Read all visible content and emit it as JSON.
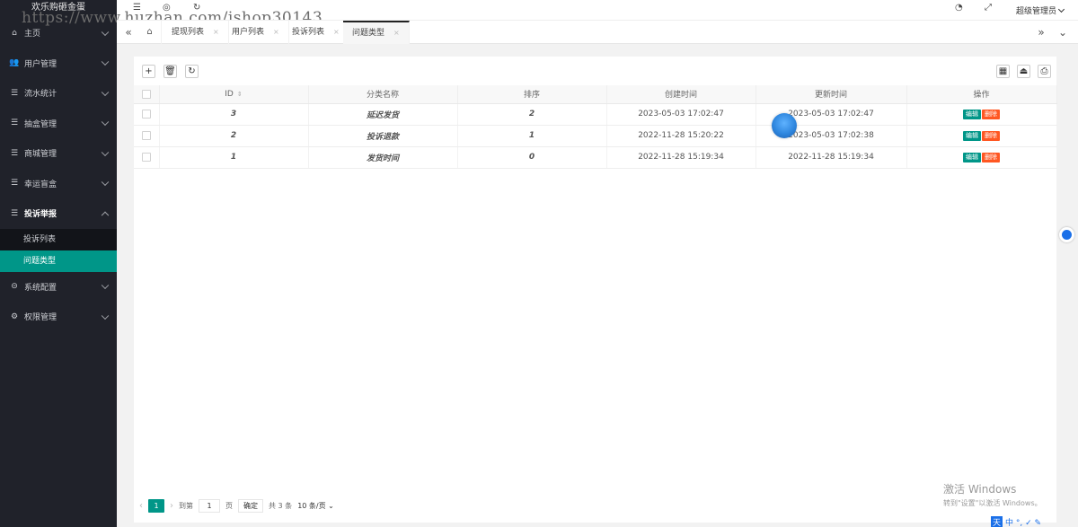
{
  "brand": "欢乐购砸金蛋",
  "watermark": "https://www.huzhan.com/ishop30143",
  "header": {
    "user": "超级管理员"
  },
  "sidebar": {
    "items": [
      {
        "label": "主页",
        "icon": "home-icon",
        "glyph": "⌂"
      },
      {
        "label": "用户管理",
        "icon": "users-icon",
        "glyph": "👥"
      },
      {
        "label": "流水统计",
        "icon": "list-icon",
        "glyph": "☰"
      },
      {
        "label": "抽盒管理",
        "icon": "list-icon",
        "glyph": "☰"
      },
      {
        "label": "商城管理",
        "icon": "list-icon",
        "glyph": "☰"
      },
      {
        "label": "幸运盲盒",
        "icon": "list-icon",
        "glyph": "☰"
      },
      {
        "label": "投诉举报",
        "icon": "list-icon",
        "glyph": "☰"
      }
    ],
    "sub_items": [
      "投诉列表",
      "问题类型"
    ],
    "items_after": [
      {
        "label": "系统配置",
        "icon": "settings-icon",
        "glyph": "⊝"
      },
      {
        "label": "权限管理",
        "icon": "gear-icon",
        "glyph": "⚙"
      }
    ]
  },
  "tabs": [
    "提现列表",
    "用户列表",
    "投诉列表",
    "问题类型"
  ],
  "tab_close": "×",
  "table": {
    "columns": [
      "ID",
      "分类名称",
      "排序",
      "创建时间",
      "更新时间",
      "操作"
    ],
    "rows": [
      {
        "id": "3",
        "name": "延迟发货",
        "sort": "2",
        "created": "2023-05-03 17:02:47",
        "updated": "2023-05-03 17:02:47"
      },
      {
        "id": "2",
        "name": "投诉退款",
        "sort": "1",
        "created": "2022-11-28 15:20:22",
        "updated": "2023-05-03 17:02:38"
      },
      {
        "id": "1",
        "name": "发货时间",
        "sort": "0",
        "created": "2022-11-28 15:19:34",
        "updated": "2022-11-28 15:19:34"
      }
    ],
    "edit_label": "编辑",
    "delete_label": "删除"
  },
  "pager": {
    "current": "1",
    "goto_label": "到第",
    "goto_value": "1",
    "page_unit": "页",
    "confirm": "确定",
    "total": "共 3 条",
    "page_size": "10 条/页"
  },
  "windows": {
    "line1": "激活 Windows",
    "line2": "转到\"设置\"以激活 Windows。"
  },
  "ime": "中 °, ✓ ✎"
}
